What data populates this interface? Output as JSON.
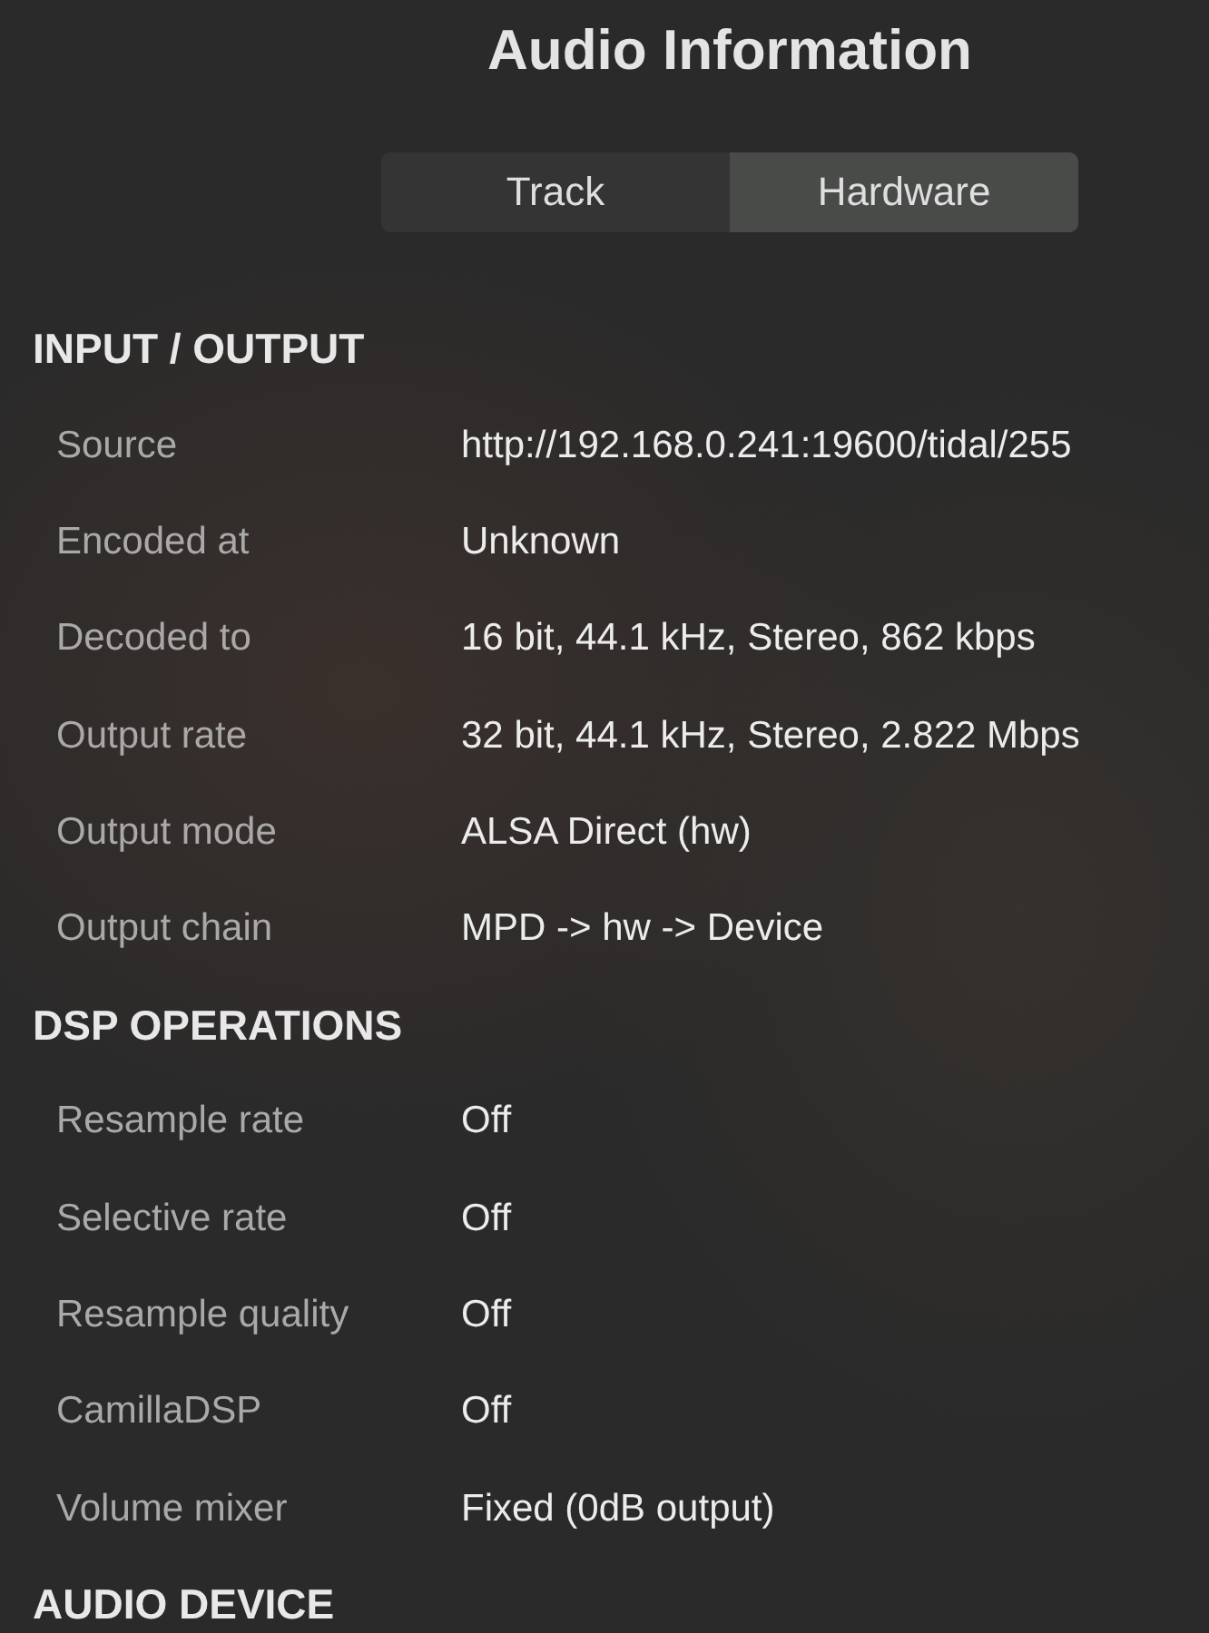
{
  "title": "Audio Information",
  "tabs": [
    {
      "label": "Track",
      "selected": false
    },
    {
      "label": "Hardware",
      "selected": true
    }
  ],
  "sections": [
    {
      "heading": "INPUT / OUTPUT",
      "rows": [
        {
          "label": "Source",
          "value": "http://192.168.0.241:19600/tidal/255"
        },
        {
          "label": "Encoded at",
          "value": "Unknown"
        },
        {
          "label": "Decoded to",
          "value": "16 bit, 44.1 kHz, Stereo, 862 kbps"
        },
        {
          "label": "Output rate",
          "value": "32 bit, 44.1 kHz, Stereo, 2.822 Mbps"
        },
        {
          "label": "Output mode",
          "value": "ALSA Direct (hw)"
        },
        {
          "label": "Output chain",
          "value": "MPD -> hw -> Device"
        }
      ]
    },
    {
      "heading": "DSP OPERATIONS",
      "rows": [
        {
          "label": "Resample rate",
          "value": "Off"
        },
        {
          "label": "Selective rate",
          "value": "Off"
        },
        {
          "label": "Resample quality",
          "value": "Off"
        },
        {
          "label": "CamillaDSP",
          "value": "Off"
        },
        {
          "label": "Volume mixer",
          "value": "Fixed (0dB output)"
        }
      ]
    },
    {
      "heading": "AUDIO DEVICE"
    }
  ]
}
